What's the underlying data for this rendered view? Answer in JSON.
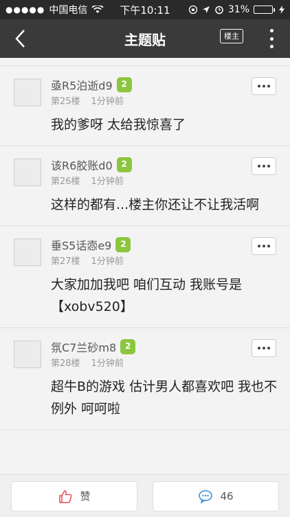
{
  "status": {
    "carrier": "中国电信",
    "time": "下午10:11",
    "battery": "31%",
    "battery_level": 0.31,
    "signal_dots": "●●●●●"
  },
  "nav": {
    "title": "主题贴",
    "owner_label": "楼主"
  },
  "posts": [
    {
      "username": "亟R5泊逝d9",
      "level": "2",
      "floor": "第25楼",
      "time": "1分钟前",
      "content": "我的爹呀 太给我惊喜了"
    },
    {
      "username": "该R6胶账d0",
      "level": "2",
      "floor": "第26楼",
      "time": "1分钟前",
      "content": "这样的都有...楼主你还让不让我活啊"
    },
    {
      "username": "垂S5话悫e9",
      "level": "2",
      "floor": "第27楼",
      "time": "1分钟前",
      "content": "大家加加我吧 咱们互动 我账号是【xobv520】"
    },
    {
      "username": "氛C7兰砂m8",
      "level": "2",
      "floor": "第28楼",
      "time": "1分钟前",
      "content": "超牛B的游戏 估计男人都喜欢吧 我也不例外 呵呵啦"
    }
  ],
  "bottom": {
    "like_label": "赞",
    "comment_count": "46"
  },
  "colors": {
    "level_badge": "#8cc63f",
    "navbar": "#3a3a3a",
    "like_icon": "#e8525a",
    "comment_icon": "#3b8fd6"
  }
}
